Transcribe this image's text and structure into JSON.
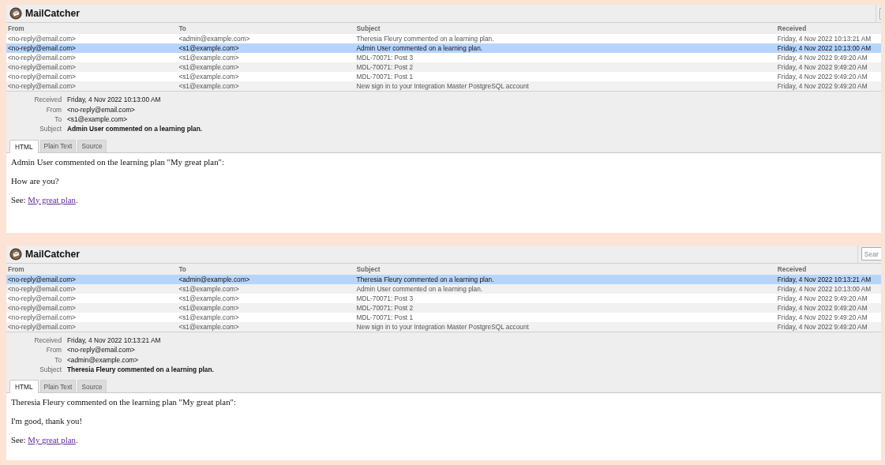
{
  "panels": [
    {
      "app_title": "MailCatcher",
      "columns": [
        "From",
        "To",
        "Subject",
        "Received"
      ],
      "messages": [
        {
          "from": "<no-reply@email.com>",
          "to": "<admin@example.com>",
          "subject": "Theresia Fleury commented on a learning plan.",
          "received": "Friday, 4 Nov 2022 10:13:21 AM",
          "selected": false
        },
        {
          "from": "<no-reply@email.com>",
          "to": "<s1@example.com>",
          "subject": "Admin User commented on a learning plan.",
          "received": "Friday, 4 Nov 2022 10:13:00 AM",
          "selected": true
        },
        {
          "from": "<no-reply@email.com>",
          "to": "<s1@example.com>",
          "subject": "MDL-70071: Post 3",
          "received": "Friday, 4 Nov 2022 9:49:20 AM",
          "selected": false
        },
        {
          "from": "<no-reply@email.com>",
          "to": "<s1@example.com>",
          "subject": "MDL-70071: Post 2",
          "received": "Friday, 4 Nov 2022 9:49:20 AM",
          "selected": false
        },
        {
          "from": "<no-reply@email.com>",
          "to": "<s1@example.com>",
          "subject": "MDL-70071: Post 1",
          "received": "Friday, 4 Nov 2022 9:49:20 AM",
          "selected": false
        },
        {
          "from": "<no-reply@email.com>",
          "to": "<s1@example.com>",
          "subject": "New sign in to your Integration Master PostgreSQL account",
          "received": "Friday, 4 Nov 2022 9:49:20 AM",
          "selected": false
        }
      ],
      "details": [
        {
          "label": "Received",
          "value": "Friday, 4 Nov 2022 10:13:00 AM",
          "kind": "normal"
        },
        {
          "label": "From",
          "value": "<no-reply@email.com>",
          "kind": "normal"
        },
        {
          "label": "To",
          "value": "<s1@example.com>",
          "kind": "normal"
        },
        {
          "label": "Subject",
          "value": "Admin User commented on a learning plan.",
          "kind": "bold"
        }
      ],
      "tabs": [
        {
          "label": "HTML",
          "selected": true
        },
        {
          "label": "Plain Text",
          "selected": false
        },
        {
          "label": "Source",
          "selected": false
        }
      ],
      "body": [
        {
          "kind": "text",
          "text": "Admin User commented on the learning plan \"My great plan\":"
        },
        {
          "kind": "text",
          "text": "How are you?"
        },
        {
          "kind": "link",
          "before": "See:",
          "link": "My great plan",
          "after": "."
        }
      ]
    },
    {
      "app_title": "MailCatcher",
      "search": {
        "placeholder": "Sear"
      },
      "columns": [
        "From",
        "To",
        "Subject",
        "Received"
      ],
      "messages": [
        {
          "from": "<no-reply@email.com>",
          "to": "<admin@example.com>",
          "subject": "Theresia Fleury commented on a learning plan.",
          "received": "Friday, 4 Nov 2022 10:13:21 AM",
          "selected": true
        },
        {
          "from": "<no-reply@email.com>",
          "to": "<s1@example.com>",
          "subject": "Admin User commented on a learning plan.",
          "received": "Friday, 4 Nov 2022 10:13:00 AM",
          "selected": false
        },
        {
          "from": "<no-reply@email.com>",
          "to": "<s1@example.com>",
          "subject": "MDL-70071: Post 3",
          "received": "Friday, 4 Nov 2022 9:49:20 AM",
          "selected": false
        },
        {
          "from": "<no-reply@email.com>",
          "to": "<s1@example.com>",
          "subject": "MDL-70071: Post 2",
          "received": "Friday, 4 Nov 2022 9:49:20 AM",
          "selected": false
        },
        {
          "from": "<no-reply@email.com>",
          "to": "<s1@example.com>",
          "subject": "MDL-70071: Post 1",
          "received": "Friday, 4 Nov 2022 9:49:20 AM",
          "selected": false
        },
        {
          "from": "<no-reply@email.com>",
          "to": "<s1@example.com>",
          "subject": "New sign in to your Integration Master PostgreSQL account",
          "received": "Friday, 4 Nov 2022 9:49:20 AM",
          "selected": false
        }
      ],
      "details": [
        {
          "label": "Received",
          "value": "Friday, 4 Nov 2022 10:13:21 AM",
          "kind": "normal"
        },
        {
          "label": "From",
          "value": "<no-reply@email.com>",
          "kind": "normal"
        },
        {
          "label": "To",
          "value": "<admin@example.com>",
          "kind": "normal"
        },
        {
          "label": "Subject",
          "value": "Theresia Fleury commented on a learning plan.",
          "kind": "bold"
        }
      ],
      "tabs": [
        {
          "label": "HTML",
          "selected": true
        },
        {
          "label": "Plain Text",
          "selected": false
        },
        {
          "label": "Source",
          "selected": false
        }
      ],
      "body": [
        {
          "kind": "text",
          "text": "Theresia Fleury commented on the learning plan \"My great plan\":"
        },
        {
          "kind": "text",
          "text": "I'm good, thank you!"
        },
        {
          "kind": "link",
          "before": "See:",
          "link": "My great plan",
          "after": "."
        }
      ]
    }
  ]
}
